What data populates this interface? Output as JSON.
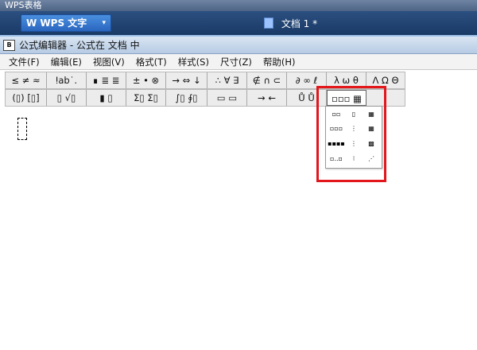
{
  "outer_window": {
    "title": "WPS表格"
  },
  "wps_bar": {
    "app_button_label": "W  WPS 文字",
    "app_button_caret": "▾",
    "doc_tab_label": "文档 1 *"
  },
  "editor_window": {
    "title": "公式编辑器 - 公式在 文档  中",
    "app_icon_text": "B"
  },
  "menu": [
    "文件(F)",
    "编辑(E)",
    "视图(V)",
    "格式(T)",
    "样式(S)",
    "尺寸(Z)",
    "帮助(H)"
  ],
  "toolbar_row1": [
    {
      "label": "≤ ≠ ≈",
      "name": "relations-palette"
    },
    {
      "label": "ⵑab˙.",
      "name": "spaces-ellipses-palette"
    },
    {
      "label": "∎ ≣ ≣",
      "name": "embellishments-palette"
    },
    {
      "label": "± • ⊗",
      "name": "operators-palette"
    },
    {
      "label": "→ ⇔ ↓",
      "name": "arrows-palette"
    },
    {
      "label": "∴ ∀ ∃",
      "name": "logical-palette"
    },
    {
      "label": "∉ ∩ ⊂",
      "name": "set-theory-palette"
    },
    {
      "label": "∂ ∞ ℓ",
      "name": "misc-symbols-palette"
    },
    {
      "label": "λ ω θ",
      "name": "greek-lower-palette"
    },
    {
      "label": "Λ Ω Θ",
      "name": "greek-upper-palette"
    }
  ],
  "toolbar_row2": [
    {
      "label": "(▯) [▯]",
      "name": "fences-palette"
    },
    {
      "label": "▯ √▯",
      "name": "fractions-radicals-palette"
    },
    {
      "label": "▮ ▯",
      "name": "subscript-superscript-palette"
    },
    {
      "label": "Σ▯ Σ▯",
      "name": "summations-palette"
    },
    {
      "label": "∫▯ ∮▯",
      "name": "integrals-palette"
    },
    {
      "label": "▭ ▭",
      "name": "underbar-overbar-palette"
    },
    {
      "label": "→ ←",
      "name": "labeled-arrows-palette"
    },
    {
      "label": "Ů Ů",
      "name": "products-set-palette"
    },
    {
      "label": "▫▫▫ ▦",
      "name": "matrices-palette"
    }
  ],
  "palette_items": [
    {
      "label": "▫▫",
      "name": "matrix-1x2-template"
    },
    {
      "label": "▯",
      "name": "matrix-2x1-template"
    },
    {
      "label": "▦",
      "name": "matrix-2x2-template"
    },
    {
      "label": "▫▫▫",
      "name": "matrix-1x3-template"
    },
    {
      "label": "⋮",
      "name": "matrix-3x1-template"
    },
    {
      "label": "▦",
      "name": "matrix-3x3-template"
    },
    {
      "label": "▪▪▪▪",
      "name": "matrix-1xn-template"
    },
    {
      "label": "⋮",
      "name": "matrix-nx1-template"
    },
    {
      "label": "▩",
      "name": "matrix-mxn-template"
    },
    {
      "label": "▫..▫",
      "name": "matrix-row-dots-template"
    },
    {
      "label": "⁝",
      "name": "matrix-col-dots-template"
    },
    {
      "label": "⋰",
      "name": "matrix-diag-template"
    }
  ],
  "colors": {
    "highlight": "#e2161b",
    "wps_accent": "#2a66bf"
  }
}
